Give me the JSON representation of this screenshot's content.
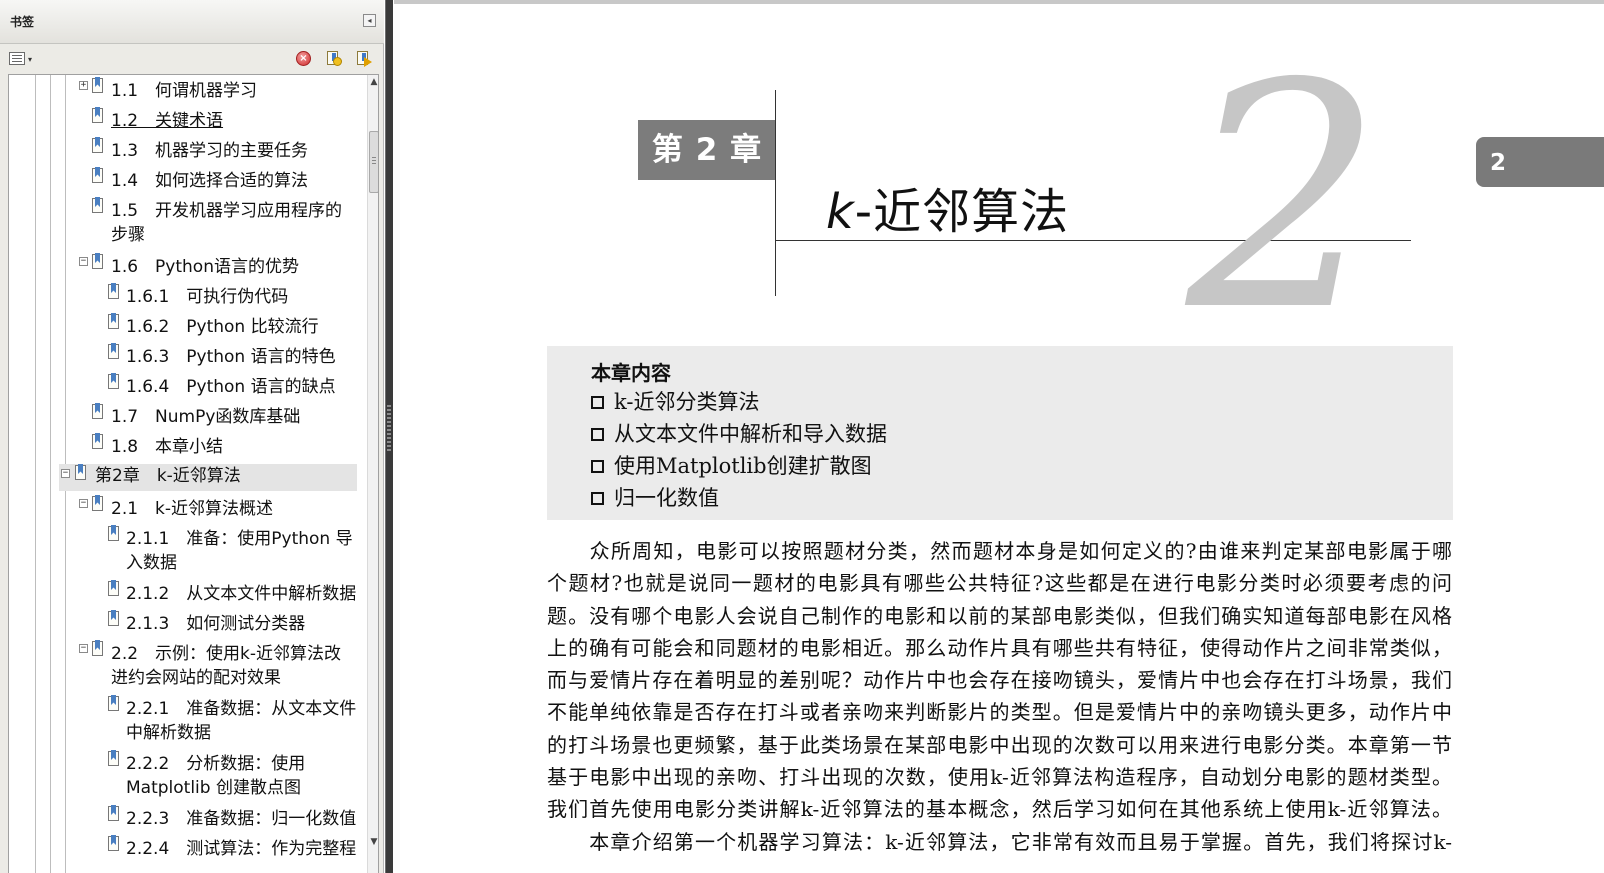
{
  "bookmarks_panel": {
    "title": "书签",
    "collapse_glyph": "◂",
    "toolbar": {
      "options_icon": "options-icon",
      "delete_icon": "delete-bookmark-icon",
      "new_icon": "new-bookmark-icon",
      "expand_icon": "expand-bookmark-icon"
    },
    "items": [
      {
        "label": "1.1　何谓机器学习",
        "toggle": "+"
      },
      {
        "label": "1.2　关键术语"
      },
      {
        "label": "1.3　机器学习的主要任务"
      },
      {
        "label": "1.4　如何选择合适的算法"
      },
      {
        "label": "1.5　开发机器学习应用程序的",
        "label2": "步骤"
      },
      {
        "label": "1.6　Python语言的优势",
        "toggle": "−"
      },
      {
        "label": "1.6.1　可执行伪代码"
      },
      {
        "label": "1.6.2　Python 比较流行"
      },
      {
        "label": "1.6.3　Python 语言的特色"
      },
      {
        "label": "1.6.4　Python 语言的缺点"
      },
      {
        "label": "1.7　NumPy函数库基础"
      },
      {
        "label": "1.8　本章小结"
      },
      {
        "label": "第2章　k-近邻算法",
        "toggle": "−"
      },
      {
        "label": "2.1　k-近邻算法概述",
        "toggle": "−"
      },
      {
        "label": "2.1.1　准备：使用Python 导",
        "label2": "入数据"
      },
      {
        "label": "2.1.2　从文本文件中解析数据"
      },
      {
        "label": "2.1.3　如何测试分类器"
      },
      {
        "label": "2.2　示例：使用k-近邻算法改",
        "label2": "进约会网站的配对效果",
        "toggle": "−"
      },
      {
        "label": "2.2.1　准备数据：从文本文件",
        "label2": "中解析数据"
      },
      {
        "label": "2.2.2　分析数据：使用",
        "label2": "Matplotlib 创建散点图"
      },
      {
        "label": "2.2.3　准备数据：归一化数值"
      },
      {
        "label": "2.2.4　测试算法：作为完整程"
      }
    ]
  },
  "document": {
    "chapter_label": "第 2 章",
    "chapter_title_italic": "k",
    "chapter_title_rest": "-近邻算法",
    "chapter_number": "2",
    "side_tab": "2",
    "summary": {
      "title": "本章内容",
      "items": [
        "k-近邻分类算法",
        "从文本文件中解析和导入数据",
        "使用Matplotlib创建扩散图",
        "归一化数值"
      ]
    },
    "body_lines": [
      "　　众所周知，电影可以按照题材分类，然而题材本身是如何定义的?由谁来判定某部电影属于哪",
      "个题材?也就是说同一题材的电影具有哪些公共特征?这些都是在进行电影分类时必须要考虑的问",
      "题。没有哪个电影人会说自己制作的电影和以前的某部电影类似，但我们确实知道每部电影在风格",
      "上的确有可能会和同题材的电影相近。那么动作片具有哪些共有特征，使得动作片之间非常类似，",
      "而与爱情片存在着明显的差别呢？动作片中也会存在接吻镜头，爱情片中也会存在打斗场景，我们",
      "不能单纯依靠是否存在打斗或者亲吻来判断影片的类型。但是爱情片中的亲吻镜头更多，动作片中",
      "的打斗场景也更频繁，基于此类场景在某部电影中出现的次数可以用来进行电影分类。本章第一节",
      "基于电影中出现的亲吻、打斗出现的次数，使用k-近邻算法构造程序，自动划分电影的题材类型。",
      "我们首先使用电影分类讲解k-近邻算法的基本概念，然后学习如何在其他系统上使用k-近邻算法。",
      "　　本章介绍第一个机器学习算法：k-近邻算法，它非常有效而且易于掌握。首先，我们将探讨k-"
    ]
  }
}
